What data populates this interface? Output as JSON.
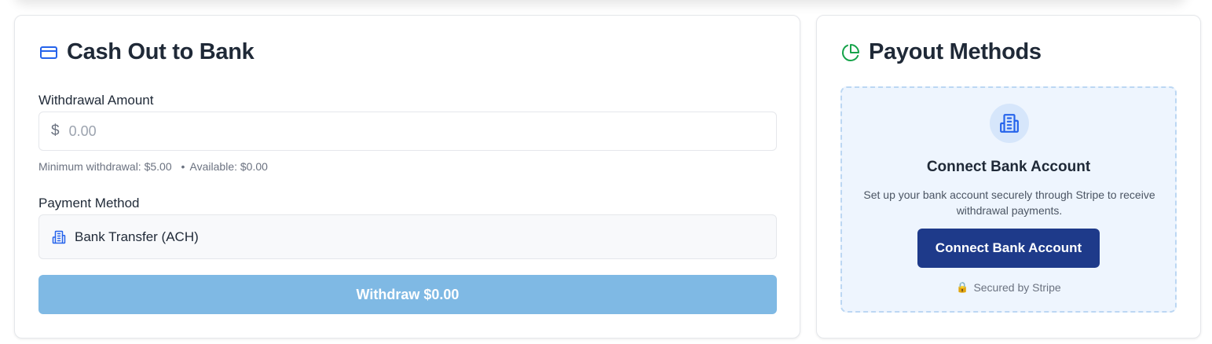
{
  "cashout": {
    "title": "Cash Out to Bank",
    "amount_label": "Withdrawal Amount",
    "currency_symbol": "$",
    "amount_value": "",
    "amount_placeholder": "0.00",
    "minimum_text": "Minimum withdrawal: $5.00",
    "bullet": "•",
    "available_text": "Available: $0.00",
    "method_label": "Payment Method",
    "method_value": "Bank Transfer (ACH)",
    "withdraw_button": "Withdraw $0.00"
  },
  "payout": {
    "title": "Payout Methods",
    "connect_title": "Connect Bank Account",
    "connect_description": "Set up your bank account securely through Stripe to receive withdrawal payments.",
    "connect_button": "Connect Bank Account",
    "secured_text": "Secured by Stripe",
    "lock_glyph": "🔒"
  },
  "icons": {
    "card": "credit-card-icon",
    "pie": "pie-chart-icon",
    "bank": "bank-building-icon",
    "lock": "lock-icon"
  },
  "colors": {
    "accent_blue": "#2563eb",
    "accent_green": "#16a34a",
    "withdraw_disabled": "#7fb9e4",
    "connect_button": "#1e3a8a",
    "panel_bg": "#eef5fe",
    "panel_border": "#bcd7f3"
  }
}
